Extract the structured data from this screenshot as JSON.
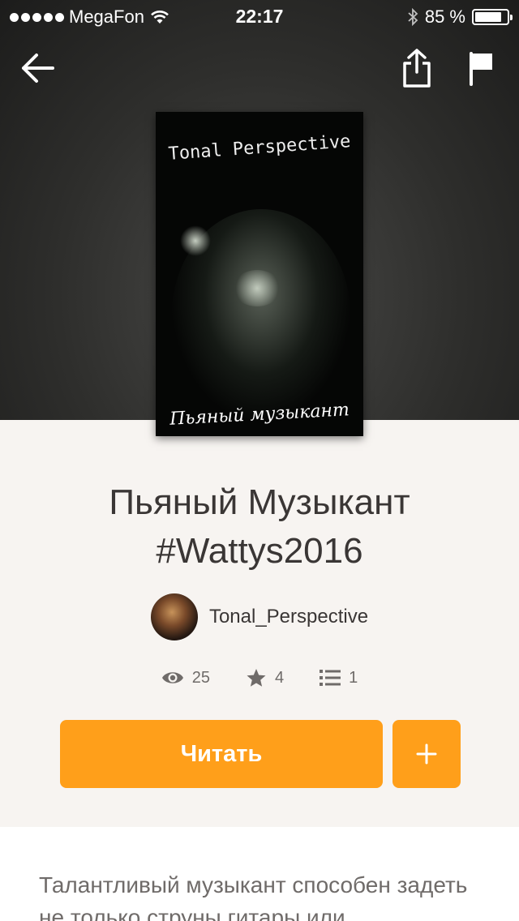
{
  "status_bar": {
    "carrier": "MegaFon",
    "time": "22:17",
    "battery": "85 %",
    "battery_level": 0.85
  },
  "nav": {
    "back_icon": "arrow-left-icon",
    "share_icon": "share-icon",
    "flag_icon": "flag-icon"
  },
  "cover": {
    "top_text": "Tonal Perspective",
    "bottom_text": "Пьяный музыкант"
  },
  "story": {
    "title_line1": "Пьяный Музыкант",
    "title_line2": "#Wattys2016",
    "author": "Tonal_Perspective"
  },
  "stats": {
    "reads": "25",
    "votes": "4",
    "parts": "1"
  },
  "actions": {
    "read_label": "Читать",
    "add_label": "+"
  },
  "description": "Талантливый музыкант способен задеть не только струны гитары или",
  "colors": {
    "accent": "#ff9f1a",
    "background": "#f7f4f1",
    "text_dark": "#3a3635",
    "text_muted": "#6f6b69"
  }
}
